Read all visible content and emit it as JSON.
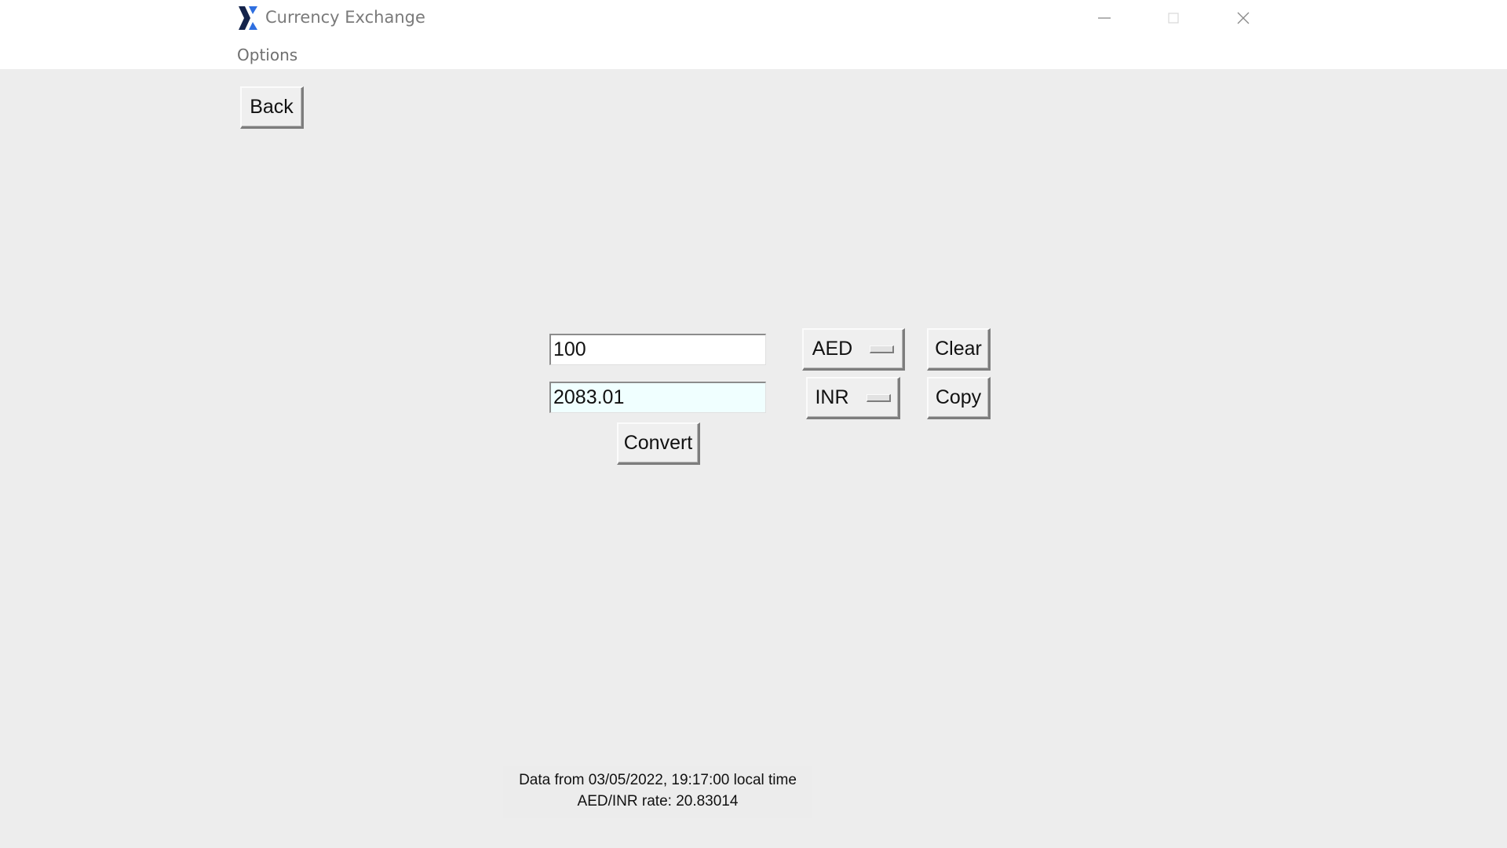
{
  "window": {
    "title": "Currency Exchange",
    "app_icon": "x-logo-icon",
    "controls": [
      "minimize",
      "maximize",
      "close"
    ]
  },
  "menubar": {
    "items": [
      {
        "label": "Options"
      }
    ]
  },
  "toolbar": {
    "back_label": "Back"
  },
  "converter": {
    "amount_value": "100",
    "result_value": "2083.01",
    "from_currency": "AED",
    "to_currency": "INR",
    "convert_label": "Convert",
    "clear_label": "Clear",
    "copy_label": "Copy"
  },
  "status": {
    "data_line": "Data from 03/05/2022, 19:17:00 local time",
    "rate_line": "AED/INR rate: 20.83014"
  },
  "colors": {
    "background": "#ededed",
    "result_field_bg": "#f0ffff",
    "logo_dark": "#14234b",
    "logo_accent": "#2f6fe0"
  }
}
